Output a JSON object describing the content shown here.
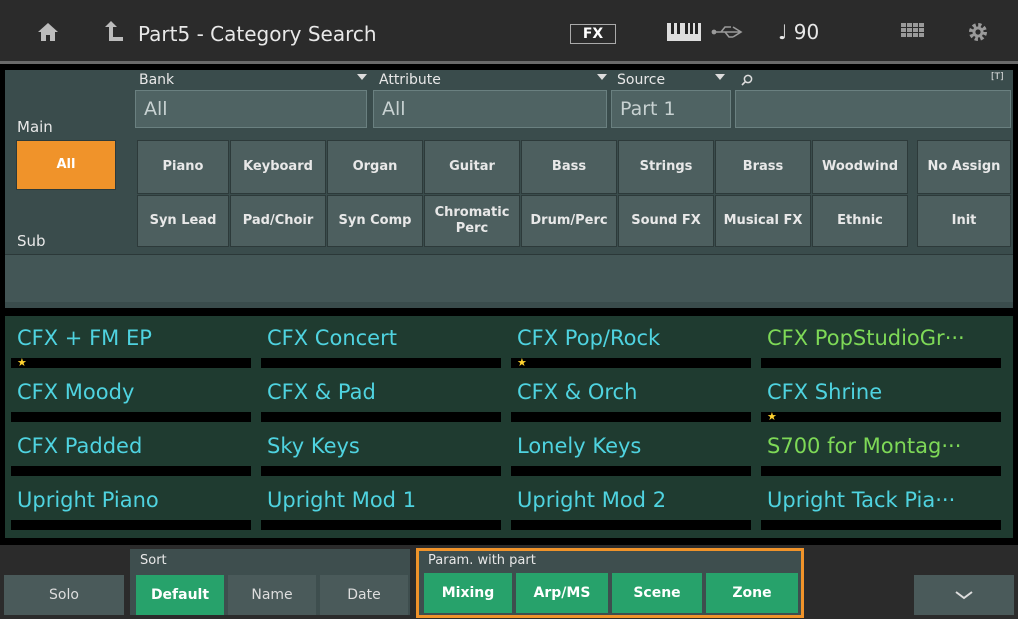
{
  "header": {
    "title": "Part5 - Category Search",
    "fx_label": "FX",
    "tempo": "90"
  },
  "filters": {
    "bank_label": "Bank",
    "bank_value": "All",
    "attribute_label": "Attribute",
    "attribute_value": "All",
    "source_label": "Source",
    "source_value": "Part 1",
    "search_hint": "[T]"
  },
  "categories": {
    "main_label": "Main",
    "sub_label": "Sub",
    "all_label": "All",
    "row1": [
      "Piano",
      "Keyboard",
      "Organ",
      "Guitar",
      "Bass",
      "Strings",
      "Brass",
      "Woodwind"
    ],
    "row1_extra": "No Assign",
    "row2": [
      "Syn Lead",
      "Pad/Choir",
      "Syn Comp",
      "Chromatic Perc",
      "Drum/Perc",
      "Sound FX",
      "Musical FX",
      "Ethnic"
    ],
    "row2_extra": "Init"
  },
  "results": [
    {
      "name": "CFX + FM EP",
      "star": true,
      "color": "#4fd3e0"
    },
    {
      "name": "CFX Concert",
      "star": false,
      "color": "#4fd3e0"
    },
    {
      "name": "CFX Pop/Rock",
      "star": true,
      "color": "#4fd3e0"
    },
    {
      "name": "CFX PopStudioGr···",
      "star": false,
      "color": "#7ed957"
    },
    {
      "name": "CFX Moody",
      "star": false,
      "color": "#4fd3e0"
    },
    {
      "name": "CFX & Pad",
      "star": false,
      "color": "#4fd3e0"
    },
    {
      "name": "CFX & Orch",
      "star": false,
      "color": "#4fd3e0"
    },
    {
      "name": "CFX Shrine",
      "star": true,
      "color": "#4fd3e0"
    },
    {
      "name": "CFX Padded",
      "star": false,
      "color": "#4fd3e0"
    },
    {
      "name": "Sky Keys",
      "star": false,
      "color": "#4fd3e0"
    },
    {
      "name": "Lonely Keys",
      "star": false,
      "color": "#4fd3e0"
    },
    {
      "name": "S700 for Montag···",
      "star": false,
      "color": "#7ed957"
    },
    {
      "name": "Upright Piano",
      "star": false,
      "color": "#4fd3e0"
    },
    {
      "name": "Upright Mod 1",
      "star": false,
      "color": "#4fd3e0"
    },
    {
      "name": "Upright Mod 2",
      "star": false,
      "color": "#4fd3e0"
    },
    {
      "name": "Upright Tack Pia···",
      "star": false,
      "color": "#4fd3e0"
    }
  ],
  "bottom": {
    "solo_label": "Solo",
    "sort_label": "Sort",
    "sort_default": "Default",
    "sort_name": "Name",
    "sort_date": "Date",
    "param_label": "Param. with part",
    "param_mixing": "Mixing",
    "param_arp": "Arp/MS",
    "param_scene": "Scene",
    "param_zone": "Zone"
  }
}
